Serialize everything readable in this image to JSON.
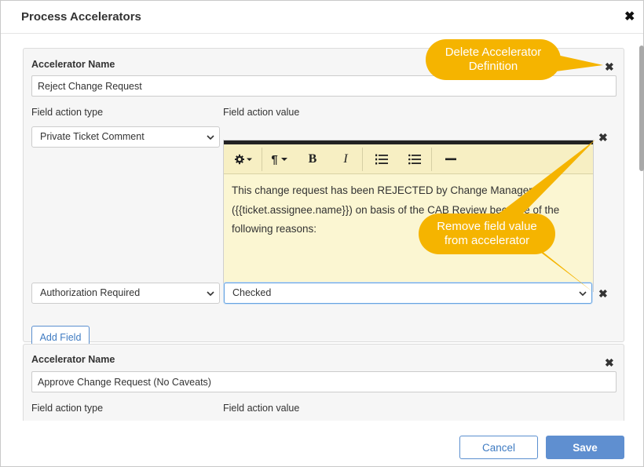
{
  "dialog": {
    "title": "Process Accelerators",
    "close_glyph": "✖"
  },
  "accelerators": [
    {
      "name_label": "Accelerator Name",
      "name_value": "Reject Change Request",
      "type_label": "Field action type",
      "value_label": "Field action value",
      "fields": [
        {
          "type": "Private Ticket Comment",
          "editor_text": "This change request has been REJECTED by Change Manager ({{ticket.assignee.name}}) on basis of the CAB Review because of the following reasons:"
        },
        {
          "type": "Authorization Required",
          "value": "Checked"
        }
      ],
      "add_field_label": "Add Field"
    },
    {
      "name_label": "Accelerator Name",
      "name_value": "Approve Change Request (No Caveats)",
      "type_label": "Field action type",
      "value_label": "Field action value"
    }
  ],
  "editor_toolbar": {
    "icons": [
      "gear-icon",
      "paragraph-icon",
      "bold-icon",
      "italic-icon",
      "ordered-list-icon",
      "bullet-list-icon",
      "horizontal-rule-icon"
    ],
    "paragraph_glyph": "¶",
    "bold_glyph": "B",
    "italic_glyph": "I"
  },
  "callouts": {
    "delete_accelerator": "Delete Accelerator Definition",
    "remove_field": "Remove field value from accelerator",
    "color": "#F5B400"
  },
  "footer": {
    "cancel_label": "Cancel",
    "save_label": "Save"
  },
  "colors": {
    "primary": "#5F8FD0",
    "editor_bg": "#FBF6D2",
    "card_bg": "#F6F6F6"
  }
}
